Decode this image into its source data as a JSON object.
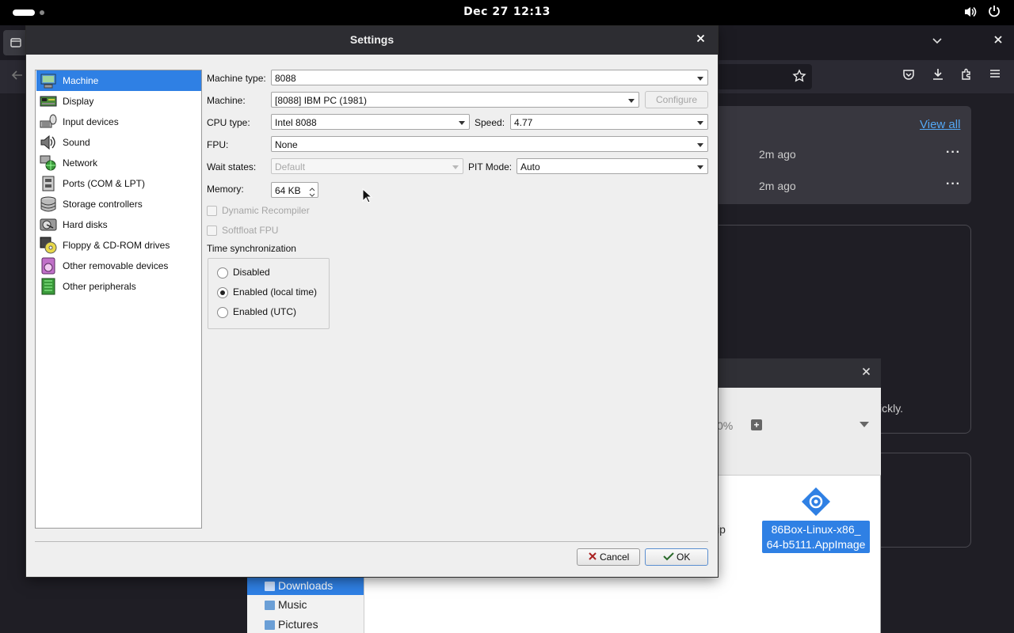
{
  "topbar": {
    "date": "Dec 27",
    "time": "12:13"
  },
  "background": {
    "downloads_card": {
      "view_all": "View all",
      "items": [
        {
          "time": "2m ago"
        },
        {
          "time": "2m ago"
        }
      ]
    },
    "partial_text": "ickly.",
    "dialog": {
      "percent": "0%",
      "zip_text": "ip",
      "file_label_line1": "86Box-Linux-x86_",
      "file_label_line2": "64-b5111.AppImage"
    },
    "file_manager": {
      "places": [
        {
          "label": "Downloads",
          "selected": true
        },
        {
          "label": "Music",
          "selected": false
        },
        {
          "label": "Pictures",
          "selected": false
        }
      ]
    }
  },
  "settings": {
    "title": "Settings",
    "categories": [
      {
        "label": "Machine",
        "icon": "machine-icon",
        "selected": true
      },
      {
        "label": "Display",
        "icon": "display-icon"
      },
      {
        "label": "Input devices",
        "icon": "input-devices-icon"
      },
      {
        "label": "Sound",
        "icon": "sound-icon"
      },
      {
        "label": "Network",
        "icon": "network-icon"
      },
      {
        "label": "Ports (COM & LPT)",
        "icon": "ports-icon"
      },
      {
        "label": "Storage controllers",
        "icon": "storage-controllers-icon"
      },
      {
        "label": "Hard disks",
        "icon": "hard-disks-icon"
      },
      {
        "label": "Floppy & CD-ROM drives",
        "icon": "floppy-cdrom-icon"
      },
      {
        "label": "Other removable devices",
        "icon": "removable-devices-icon"
      },
      {
        "label": "Other peripherals",
        "icon": "peripherals-icon"
      }
    ],
    "machine": {
      "machine_type_label": "Machine type:",
      "machine_type_value": "8088",
      "machine_label": "Machine:",
      "machine_value": "[8088] IBM PC (1981)",
      "configure_label": "Configure",
      "cpu_type_label": "CPU type:",
      "cpu_type_value": "Intel 8088",
      "speed_label": "Speed:",
      "speed_value": "4.77",
      "fpu_label": "FPU:",
      "fpu_value": "None",
      "wait_states_label": "Wait states:",
      "wait_states_value": "Default",
      "pit_mode_label": "PIT Mode:",
      "pit_mode_value": "Auto",
      "memory_label": "Memory:",
      "memory_value": "64 KB",
      "dynamic_recompiler_label": "Dynamic Recompiler",
      "softfloat_fpu_label": "Softfloat FPU",
      "time_sync_label": "Time synchronization",
      "time_sync_options": [
        {
          "label": "Disabled",
          "checked": false
        },
        {
          "label": "Enabled (local time)",
          "checked": true
        },
        {
          "label": "Enabled (UTC)",
          "checked": false
        }
      ]
    },
    "buttons": {
      "cancel": "Cancel",
      "ok": "OK"
    }
  }
}
